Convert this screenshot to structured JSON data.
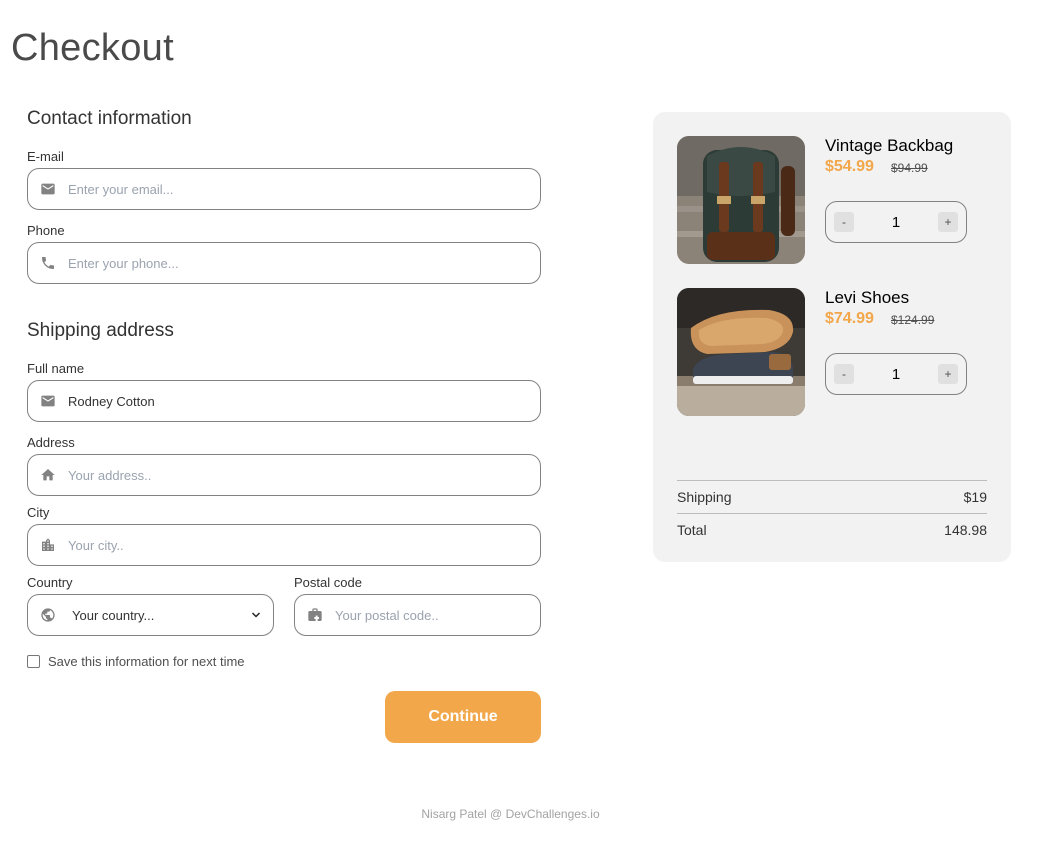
{
  "page": {
    "title": "Checkout"
  },
  "contact": {
    "title": "Contact information",
    "email_label": "E-mail",
    "email_placeholder": "Enter your email...",
    "phone_label": "Phone",
    "phone_placeholder": "Enter your phone..."
  },
  "shipping": {
    "title": "Shipping address",
    "fullname_label": "Full name",
    "fullname_value": "Rodney Cotton",
    "address_label": "Address",
    "address_placeholder": "Your address..",
    "city_label": "City",
    "city_placeholder": "Your city..",
    "country_label": "Country",
    "country_value": "Your country...",
    "postal_label": "Postal code",
    "postal_placeholder": "Your postal code..",
    "save_label": "Save this information for next time",
    "continue_label": "Continue"
  },
  "cart": {
    "items": [
      {
        "name": "Vintage Backbag",
        "price": "$54.99",
        "old_price": "$94.99",
        "qty": "1",
        "minus": "-",
        "plus": "+",
        "image_icon": "backpack-photo"
      },
      {
        "name": "Levi Shoes",
        "price": "$74.99",
        "old_price": "$124.99",
        "qty": "1",
        "minus": "-",
        "plus": "+",
        "image_icon": "shoes-photo"
      }
    ],
    "shipping_label": "Shipping",
    "shipping_value": "$19",
    "total_label": "Total",
    "total_value": "148.98"
  },
  "footer": {
    "credit": "Nisarg Patel @ DevChallenges.io"
  },
  "colors": {
    "accent": "#F2A74B",
    "panel_bg": "#F2F2F2",
    "border": "#828282"
  }
}
